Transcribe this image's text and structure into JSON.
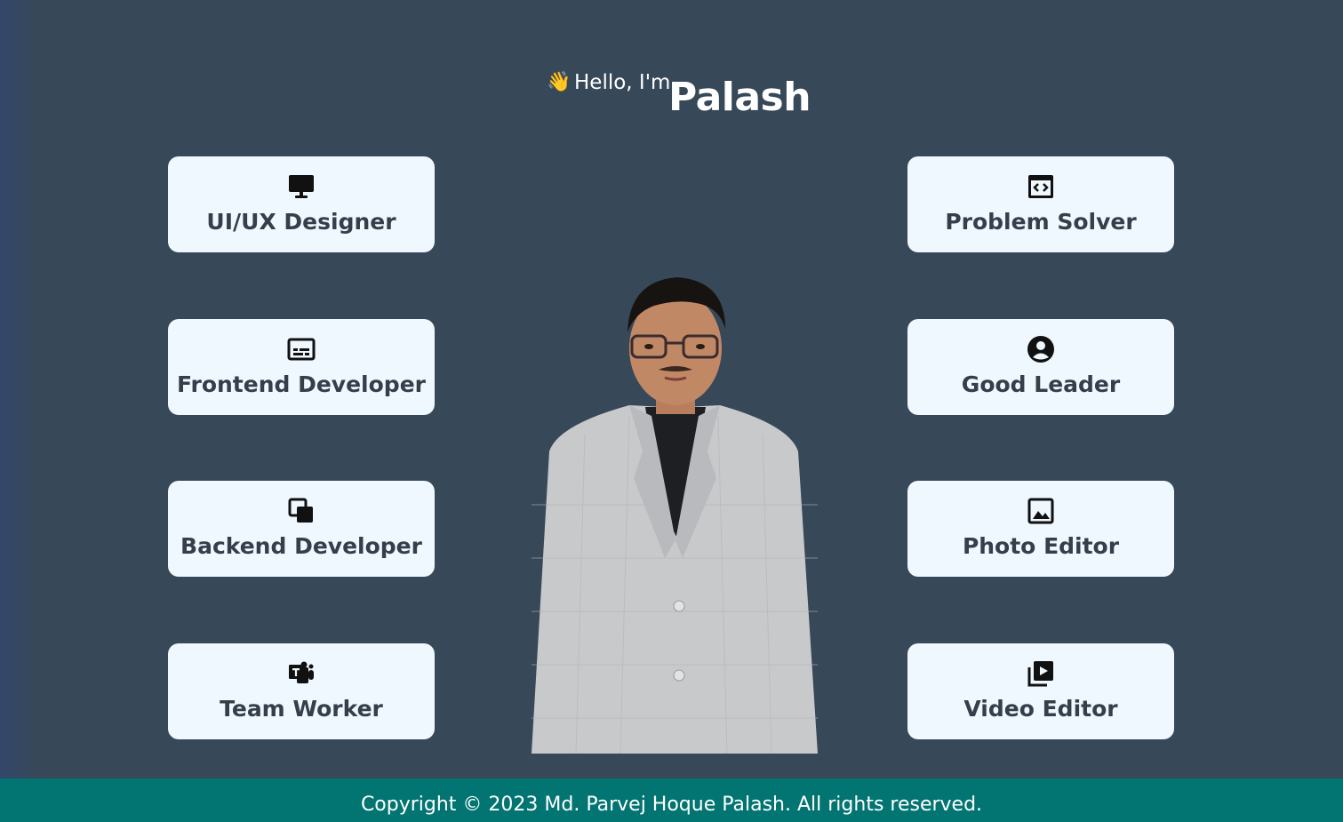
{
  "hero": {
    "wave_emoji": "👋",
    "greeting": "Hello, I'm",
    "name": "Palash"
  },
  "skills_left": [
    {
      "label": "UI/UX Designer",
      "icon": "desktop-icon"
    },
    {
      "label": "Frontend Developer",
      "icon": "subtitles-icon"
    },
    {
      "label": "Backend Developer",
      "icon": "layers-icon"
    },
    {
      "label": "Team Worker",
      "icon": "teams-icon"
    }
  ],
  "skills_right": [
    {
      "label": "Problem Solver",
      "icon": "code-window-icon"
    },
    {
      "label": "Good Leader",
      "icon": "user-circle-icon"
    },
    {
      "label": "Photo Editor",
      "icon": "image-icon"
    },
    {
      "label": "Video Editor",
      "icon": "video-library-icon"
    }
  ],
  "portrait": {
    "alt": "portrait-photo"
  },
  "footer": {
    "copyright": "Copyright © 2023 Md. Parvej Hoque Palash. All rights reserved."
  },
  "colors": {
    "background": "#374859",
    "card": "#eff8fe",
    "card_text": "#343f4b",
    "footer": "#027471",
    "text_light": "#ffffff"
  }
}
